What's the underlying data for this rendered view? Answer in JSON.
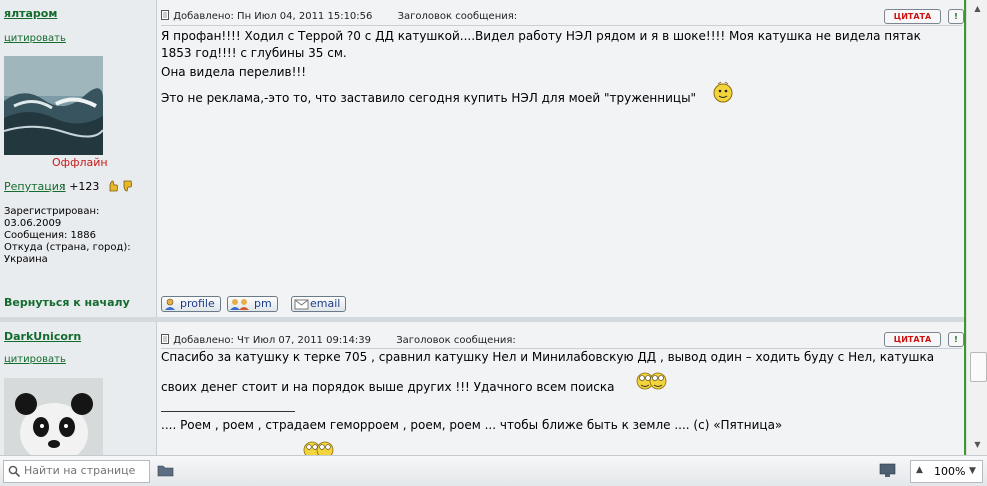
{
  "posts": [
    {
      "author": "ялтаром",
      "quote_link": "цитировать",
      "status": "Оффлайн",
      "reputation_label": "Репутация",
      "reputation_value": ": +123",
      "registered_label": "Зарегистрирован:",
      "registered_date": "03.06.2009",
      "messages": "Сообщения: 1886",
      "location_label": "Откуда (страна, город):",
      "location": "Украина",
      "added": "Добавлено: Пн Июл 04, 2011 15:10:56",
      "subject_label": "Заголовок сообщения:",
      "quote_button": "ЦИТАТА",
      "warn_button": "!",
      "lines": [
        "Я профан!!!! Ходил с Террой ?0 с ДД катушкой....Видел работу НЭЛ рядом и я в шоке!!!! Моя катушка не видела пятак",
        "1853 год!!!! с глубины 35 см.",
        "Она видела перелив!!!",
        "Это не реклама,-это то, что заставило сегодня купить НЭЛ для моей \"труженницы\""
      ],
      "back_to_top": "Вернуться к началу",
      "profile": "profile",
      "pm": "pm",
      "email": "email"
    },
    {
      "author": "DarkUnicorn",
      "quote_link": "цитировать",
      "added": "Добавлено: Чт Июл 07, 2011 09:14:39",
      "subject_label": "Заголовок сообщения:",
      "quote_button": "ЦИТАТА",
      "warn_button": "!",
      "lines": [
        "Спасибо за катушку к терке 705 , сравнил катушку Нел и Минилабовскую ДД , вывод один – ходить буду с Нел, катушка",
        "своих денег стоит и на порядок выше других !!! Удачного всем поиска"
      ],
      "signature": ".... Роем , роем , страдаем геморроем , роем, роем ... чтобы ближе быть к земле .... (с) «Пятница»"
    }
  ],
  "statusbar": {
    "find_placeholder": "Найти на странице",
    "zoom": "100%"
  }
}
